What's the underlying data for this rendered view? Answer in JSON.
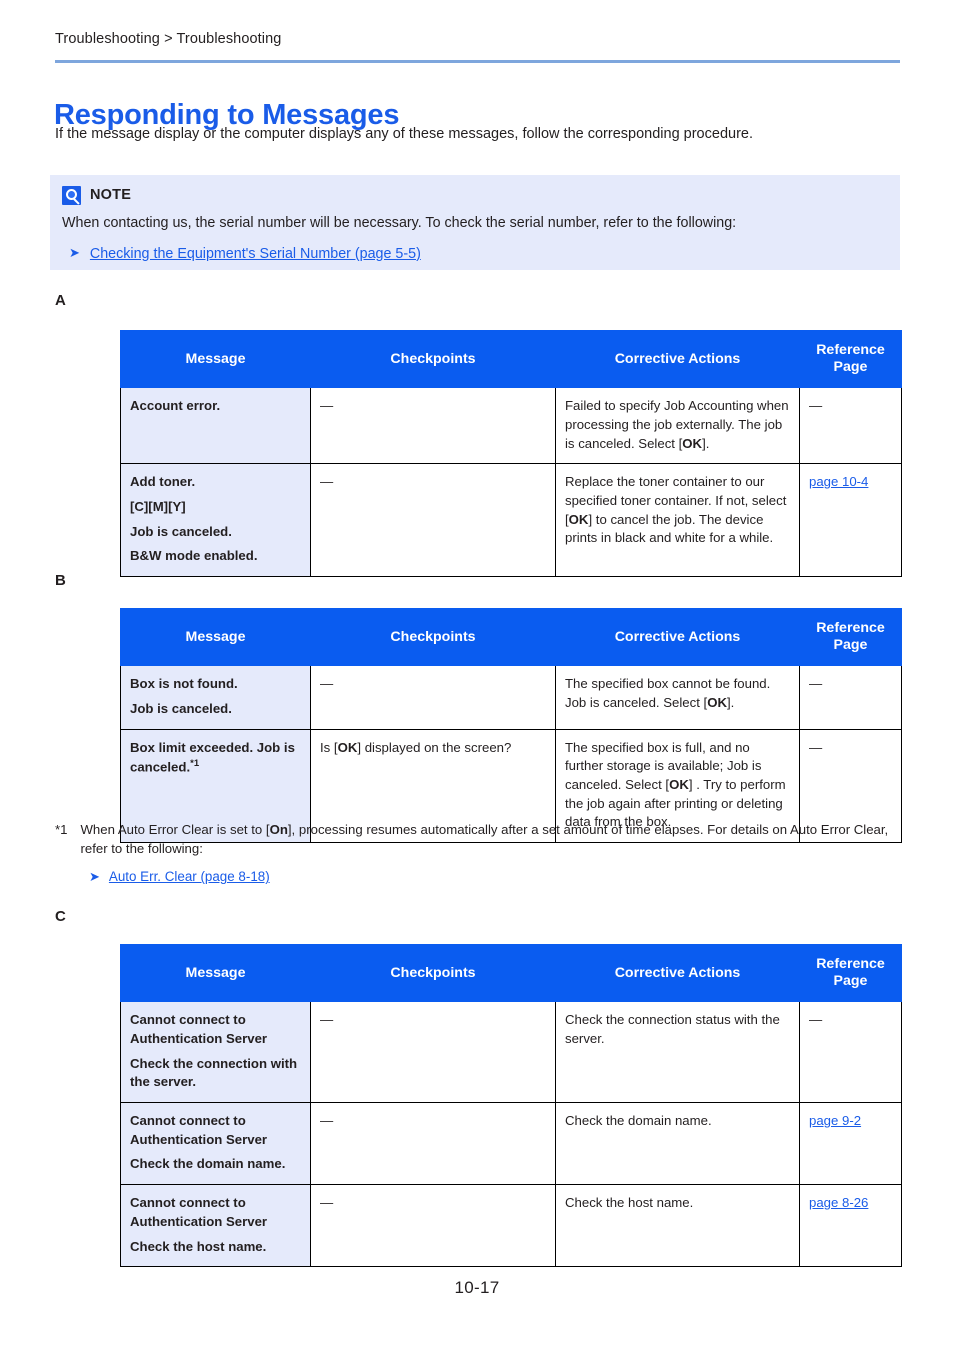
{
  "breadcrumb": "Troubleshooting > Troubleshooting",
  "title": "Responding to Messages",
  "intro": "If the message display or the computer displays any of these messages, follow the corresponding procedure.",
  "colors": {
    "accent_blue": "#1a5ce8",
    "header_blue": "#0a5cf0",
    "cell_lavender": "#e5eafb",
    "rule_blue": "#7ea6dd"
  },
  "note": {
    "icon": "note-info-icon",
    "label": "NOTE",
    "text": "When contacting us, the serial number will be necessary. To check the serial number, refer to the following:",
    "link_arrow_icon": "arrow-right-icon",
    "link": "Checking the Equipment's Serial Number (page 5-5)"
  },
  "table_headers": {
    "message": "Message",
    "checkpoints": "Checkpoints",
    "corrective_actions": "Corrective Actions",
    "reference_page": "Reference Page"
  },
  "sections": [
    {
      "letter": "A",
      "rows": [
        {
          "message_lines": [
            "Account error."
          ],
          "footnote_mark": "",
          "checkpoints": "—",
          "corrective_actions_pre": "Failed to specify Job Accounting when processing the job externally. The job is canceled. Select [",
          "corrective_actions_key": "OK",
          "corrective_actions_post": "].",
          "reference": "—",
          "reference_is_link": false
        },
        {
          "message_lines": [
            "Add toner.",
            "[C][M][Y]",
            "Job is canceled.",
            "B&W mode enabled."
          ],
          "footnote_mark": "",
          "checkpoints": "—",
          "corrective_actions_pre": "Replace the toner container to our specified toner container. If not, select [",
          "corrective_actions_key": "OK",
          "corrective_actions_post": "] to cancel the job. The device prints in black and white for a while.",
          "reference": "page 10-4",
          "reference_is_link": true
        }
      ]
    },
    {
      "letter": "B",
      "rows": [
        {
          "message_lines": [
            "Box is not found.",
            "Job is canceled."
          ],
          "footnote_mark": "",
          "checkpoints": "—",
          "corrective_actions_pre": "The specified box cannot be found. Job is canceled. Select [",
          "corrective_actions_key": "OK",
          "corrective_actions_post": "].",
          "reference": "—",
          "reference_is_link": false
        },
        {
          "message_lines": [
            "Box limit exceeded. Job is canceled."
          ],
          "footnote_mark": "*1",
          "checkpoints_pre": "Is [",
          "checkpoints_key": "OK",
          "checkpoints_post": "] displayed on the screen?",
          "checkpoints": "Is [OK] displayed on the screen?",
          "corrective_actions_pre": "The specified box is full, and no further storage is available; Job is canceled. Select [",
          "corrective_actions_key": "OK",
          "corrective_actions_post": "] . Try to perform the job again after printing or deleting data from the box.",
          "reference": "—",
          "reference_is_link": false
        }
      ]
    },
    {
      "letter": "C",
      "rows": [
        {
          "message_lines": [
            "Cannot connect to Authentication Server",
            "Check the connection with the server."
          ],
          "footnote_mark": "",
          "checkpoints": "—",
          "corrective_actions_pre": "Check the connection status with the server.",
          "corrective_actions_key": "",
          "corrective_actions_post": "",
          "reference": "—",
          "reference_is_link": false
        },
        {
          "message_lines": [
            "Cannot connect to Authentication Server",
            "Check the domain name."
          ],
          "footnote_mark": "",
          "checkpoints": "—",
          "corrective_actions_pre": "Check the domain name.",
          "corrective_actions_key": "",
          "corrective_actions_post": "",
          "reference": "page 9-2",
          "reference_is_link": true
        },
        {
          "message_lines": [
            "Cannot connect to Authentication Server",
            "Check the host name."
          ],
          "footnote_mark": "",
          "checkpoints": "—",
          "corrective_actions_pre": "Check the host name.",
          "corrective_actions_key": "",
          "corrective_actions_post": "",
          "reference": "page 8-26",
          "reference_is_link": true
        }
      ]
    }
  ],
  "footnote": {
    "mark": "*1",
    "text_pre": "When Auto Error Clear is set to [",
    "text_key": "On",
    "text_post": "], processing resumes automatically after a set amount of time elapses. For details on Auto Error Clear, refer to the following:",
    "link_arrow_icon": "arrow-right-icon",
    "link": "Auto Err. Clear (page 8-18)"
  },
  "page_number": "10-17"
}
